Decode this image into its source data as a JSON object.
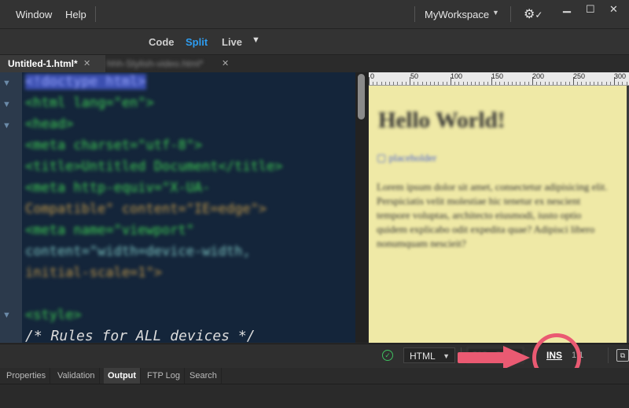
{
  "menu": {
    "window": "Window",
    "help": "Help"
  },
  "workspace": {
    "name": "MyWorkspace"
  },
  "view_modes": {
    "code": "Code",
    "split": "Split",
    "live": "Live"
  },
  "tabs": {
    "active": "Untitled-1.html*",
    "inactive": "hhh-Stylish-video.html*"
  },
  "code_lines": [
    "<!doctype html>",
    "<html lang=\"en\">",
    "<head>",
    "<meta charset=\"utf-8\">",
    "<title>Untitled Document</title>",
    "<meta http-equiv=\"X-UA-",
    "Compatible\" content=\"IE=edge\">",
    "<meta name=\"viewport\"",
    "content=\"width=device-width,",
    "initial-scale=1\">",
    "<style>"
  ],
  "code_comment": "/* Rules for ALL devices */",
  "ruler_labels": [
    "0",
    "50",
    "100",
    "150",
    "200",
    "250",
    "300"
  ],
  "preview": {
    "heading": "Hello World!",
    "image_alt": "placeholder",
    "paragraph": "Lorem ipsum dolor sit amet, consectetur adipisicing elit. Perspiciatis velit molestiae hic tenetur ex nescient tempore voluptas, architecto eiusmodi, iusto optio quidem explicabo odit expedita quae? Adipisci libero nonumquam nescieit?"
  },
  "status": {
    "language": "HTML",
    "size": "316 x 214",
    "ins": "INS",
    "position": "1:1"
  },
  "panel_tabs": [
    "Properties",
    "Validation",
    "Output",
    "FTP Log",
    "Search"
  ],
  "colors": {
    "accent": "#2d9cf0",
    "annotation": "#ea5a72",
    "preview_bg": "#efe9a6"
  }
}
